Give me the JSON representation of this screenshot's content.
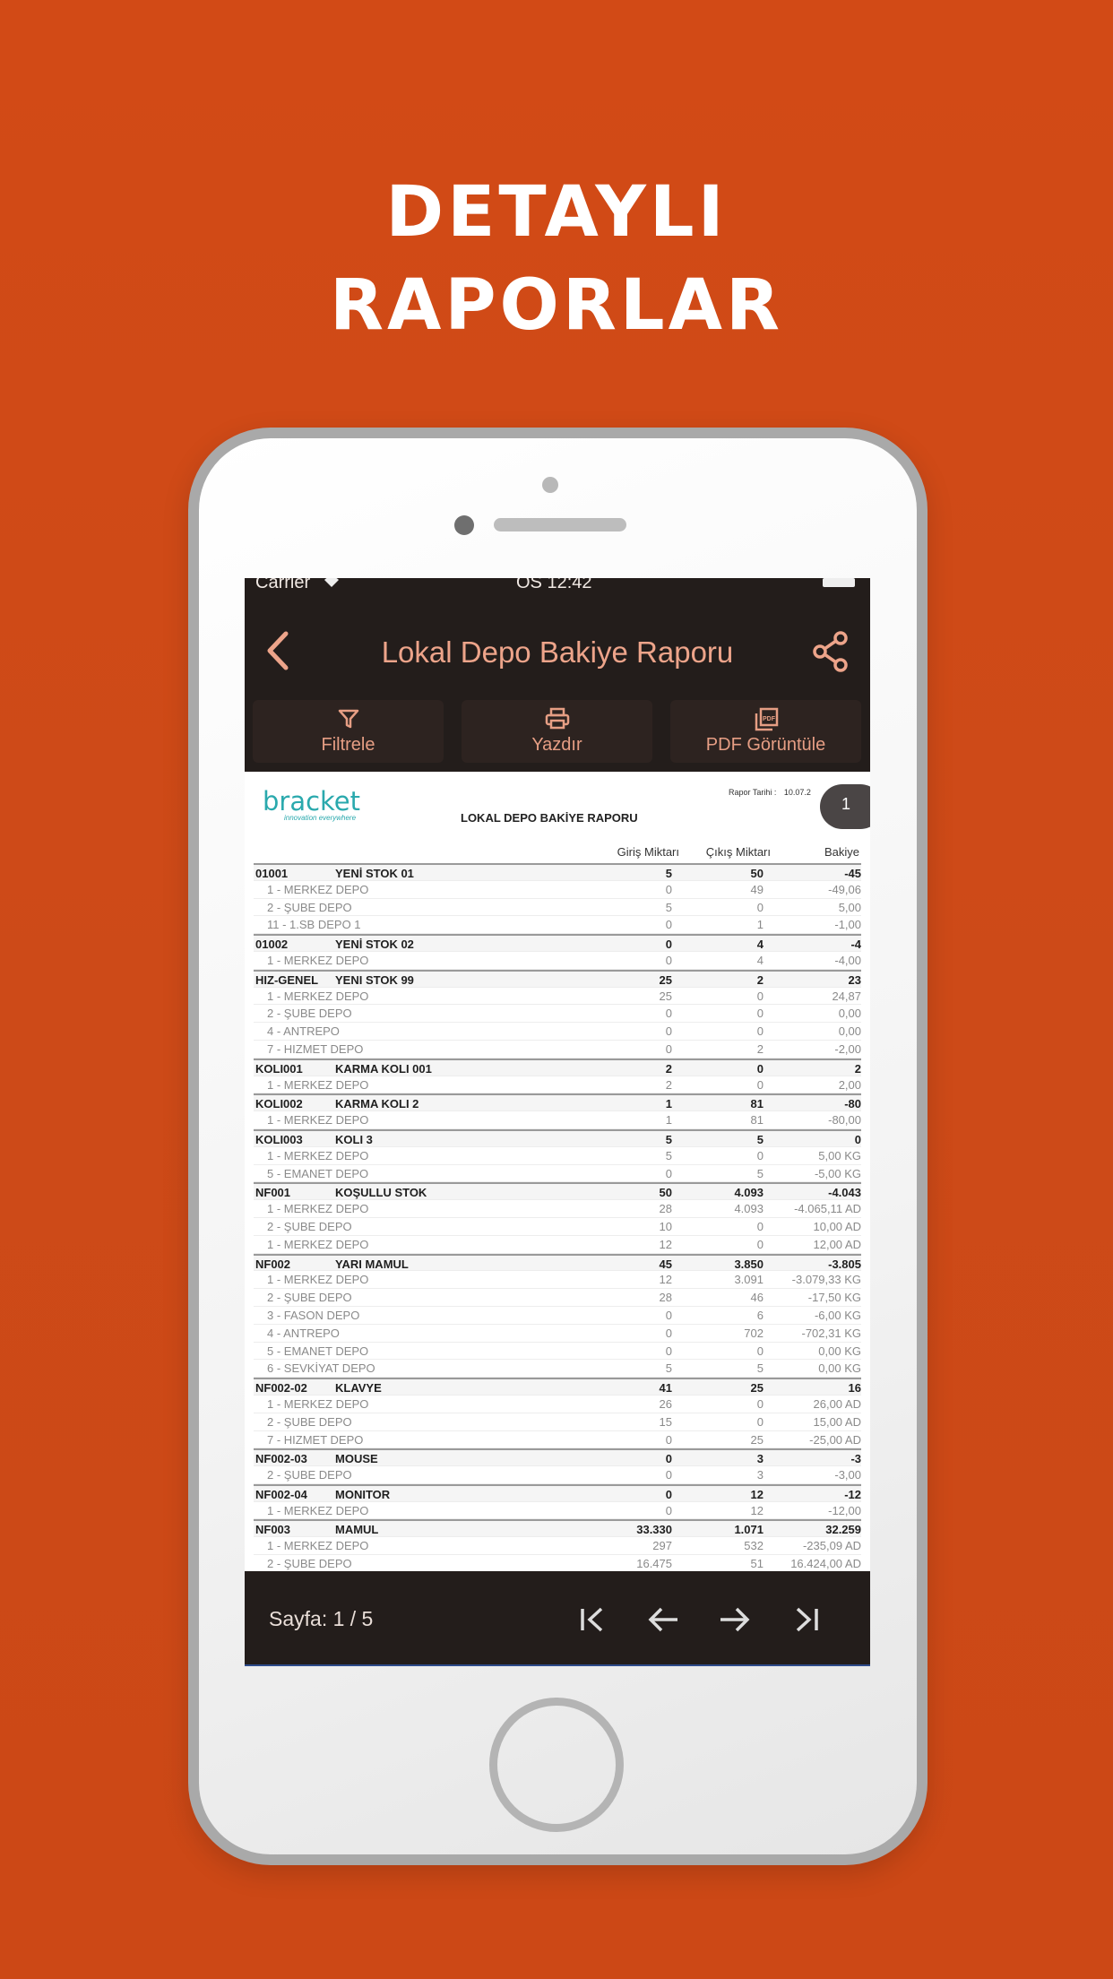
{
  "headline": {
    "line1": "DETAYLI",
    "line2": "RAPORLAR"
  },
  "status_bar": {
    "carrier": "Carrier",
    "time": "OS 12:42"
  },
  "nav": {
    "title": "Lokal Depo Bakiye Raporu"
  },
  "toolbar": {
    "filter": "Filtrele",
    "print": "Yazdır",
    "pdf": "PDF Görüntüle"
  },
  "report": {
    "logo_name": "bracket",
    "logo_tagline": "innovation everywhere",
    "title": "LOKAL DEPO BAKİYE RAPORU",
    "date_label": "Rapor Tarihi :",
    "date_value": "10.07.2",
    "page_badge": "1",
    "columns": {
      "in": "Giriş Miktarı",
      "out": "Çıkış Miktarı",
      "balance": "Bakiye"
    },
    "rows": [
      {
        "type": "head",
        "code": "01001",
        "name": "YENİ STOK 01",
        "in": "5",
        "out": "50",
        "bal": "-45"
      },
      {
        "type": "sub",
        "wh": "1 - MERKEZ DEPO",
        "in": "0",
        "out": "49",
        "bal": "-49,06"
      },
      {
        "type": "sub",
        "wh": "2 - ŞUBE DEPO",
        "in": "5",
        "out": "0",
        "bal": "5,00"
      },
      {
        "type": "sub",
        "wh": "11 - 1.SB DEPO 1",
        "in": "0",
        "out": "1",
        "bal": "-1,00"
      },
      {
        "type": "head",
        "code": "01002",
        "name": "YENİ STOK 02",
        "in": "0",
        "out": "4",
        "bal": "-4"
      },
      {
        "type": "sub",
        "wh": "1 - MERKEZ DEPO",
        "in": "0",
        "out": "4",
        "bal": "-4,00"
      },
      {
        "type": "head",
        "code": "HIZ-GENEL",
        "name": "YENI STOK 99",
        "in": "25",
        "out": "2",
        "bal": "23"
      },
      {
        "type": "sub",
        "wh": "1 - MERKEZ DEPO",
        "in": "25",
        "out": "0",
        "bal": "24,87"
      },
      {
        "type": "sub",
        "wh": "2 - ŞUBE DEPO",
        "in": "0",
        "out": "0",
        "bal": "0,00"
      },
      {
        "type": "sub",
        "wh": "4 - ANTREPO",
        "in": "0",
        "out": "0",
        "bal": "0,00"
      },
      {
        "type": "sub",
        "wh": "7 - HIZMET DEPO",
        "in": "0",
        "out": "2",
        "bal": "-2,00"
      },
      {
        "type": "head",
        "code": "KOLI001",
        "name": "KARMA KOLI 001",
        "in": "2",
        "out": "0",
        "bal": "2"
      },
      {
        "type": "sub",
        "wh": "1 - MERKEZ DEPO",
        "in": "2",
        "out": "0",
        "bal": "2,00"
      },
      {
        "type": "head",
        "code": "KOLI002",
        "name": "KARMA KOLI 2",
        "in": "1",
        "out": "81",
        "bal": "-80"
      },
      {
        "type": "sub",
        "wh": "1 - MERKEZ DEPO",
        "in": "1",
        "out": "81",
        "bal": "-80,00"
      },
      {
        "type": "head",
        "code": "KOLI003",
        "name": "KOLI 3",
        "in": "5",
        "out": "5",
        "bal": "0"
      },
      {
        "type": "sub",
        "wh": "1 - MERKEZ DEPO",
        "in": "5",
        "out": "0",
        "bal": "5,00 KG"
      },
      {
        "type": "sub",
        "wh": "5 - EMANET DEPO",
        "in": "0",
        "out": "5",
        "bal": "-5,00 KG"
      },
      {
        "type": "head",
        "code": "NF001",
        "name": "KOŞULLU STOK",
        "in": "50",
        "out": "4.093",
        "bal": "-4.043"
      },
      {
        "type": "sub",
        "wh": "1 - MERKEZ DEPO",
        "in": "28",
        "out": "4.093",
        "bal": "-4.065,11 AD"
      },
      {
        "type": "sub",
        "wh": "2 - ŞUBE DEPO",
        "in": "10",
        "out": "0",
        "bal": "10,00 AD"
      },
      {
        "type": "sub",
        "wh": "1 - MERKEZ DEPO",
        "in": "12",
        "out": "0",
        "bal": "12,00 AD"
      },
      {
        "type": "head",
        "code": "NF002",
        "name": "YARI MAMUL",
        "in": "45",
        "out": "3.850",
        "bal": "-3.805"
      },
      {
        "type": "sub",
        "wh": "1 - MERKEZ DEPO",
        "in": "12",
        "out": "3.091",
        "bal": "-3.079,33 KG"
      },
      {
        "type": "sub",
        "wh": "2 - ŞUBE DEPO",
        "in": "28",
        "out": "46",
        "bal": "-17,50 KG"
      },
      {
        "type": "sub",
        "wh": "3 - FASON DEPO",
        "in": "0",
        "out": "6",
        "bal": "-6,00 KG"
      },
      {
        "type": "sub",
        "wh": "4 - ANTREPO",
        "in": "0",
        "out": "702",
        "bal": "-702,31 KG"
      },
      {
        "type": "sub",
        "wh": "5 - EMANET DEPO",
        "in": "0",
        "out": "0",
        "bal": "0,00 KG"
      },
      {
        "type": "sub",
        "wh": "6 - SEVKİYAT DEPO",
        "in": "5",
        "out": "5",
        "bal": "0,00 KG"
      },
      {
        "type": "head",
        "code": "NF002-02",
        "name": "KLAVYE",
        "in": "41",
        "out": "25",
        "bal": "16"
      },
      {
        "type": "sub",
        "wh": "1 - MERKEZ DEPO",
        "in": "26",
        "out": "0",
        "bal": "26,00 AD"
      },
      {
        "type": "sub",
        "wh": "2 - ŞUBE DEPO",
        "in": "15",
        "out": "0",
        "bal": "15,00 AD"
      },
      {
        "type": "sub",
        "wh": "7 - HIZMET DEPO",
        "in": "0",
        "out": "25",
        "bal": "-25,00 AD"
      },
      {
        "type": "head",
        "code": "NF002-03",
        "name": "MOUSE",
        "in": "0",
        "out": "3",
        "bal": "-3"
      },
      {
        "type": "sub",
        "wh": "2 - ŞUBE DEPO",
        "in": "0",
        "out": "3",
        "bal": "-3,00"
      },
      {
        "type": "head",
        "code": "NF002-04",
        "name": "MONITOR",
        "in": "0",
        "out": "12",
        "bal": "-12"
      },
      {
        "type": "sub",
        "wh": "1 - MERKEZ DEPO",
        "in": "0",
        "out": "12",
        "bal": "-12,00"
      },
      {
        "type": "head",
        "code": "NF003",
        "name": "MAMUL",
        "in": "33.330",
        "out": "1.071",
        "bal": "32.259"
      },
      {
        "type": "sub",
        "wh": "1 - MERKEZ DEPO",
        "in": "297",
        "out": "532",
        "bal": "-235,09 AD"
      },
      {
        "type": "sub",
        "wh": "2 - ŞUBE DEPO",
        "in": "16.475",
        "out": "51",
        "bal": "16.424,00 AD"
      }
    ]
  },
  "pager": {
    "label": "Sayfa: 1 / 5"
  }
}
